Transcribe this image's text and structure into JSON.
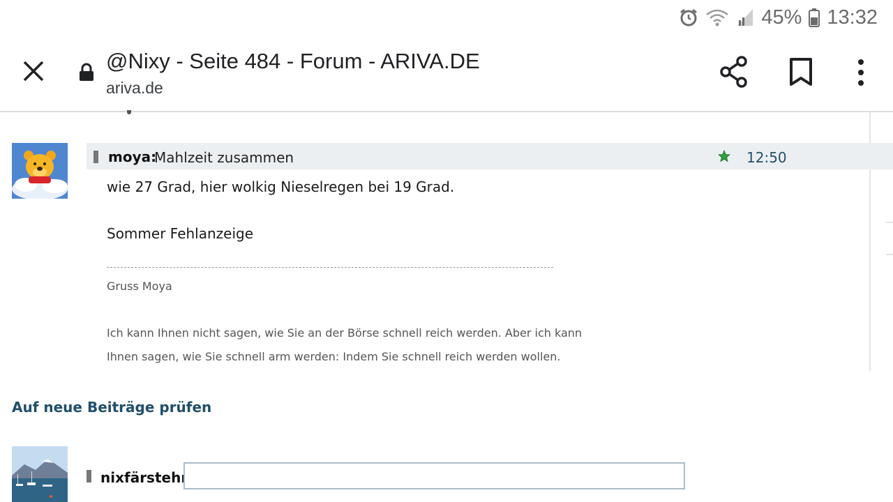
{
  "status_bar": {
    "battery_percent": "45%",
    "time": "13:32",
    "icons": [
      "alarm-icon",
      "wifi-icon",
      "signal-icon",
      "battery-icon"
    ]
  },
  "toolbar": {
    "title": "@Nixy - Seite 484 - Forum - ARIVA.DE",
    "url": "ariva.de",
    "icons": [
      "close-icon",
      "lock-icon",
      "share-icon",
      "bookmark-icon",
      "more-vert-icon"
    ]
  },
  "post": {
    "author": "moya:",
    "subject": "Mahlzeit zusammen",
    "time": "12:50",
    "body_line1": "wie 27 Grad, hier wolkig Nieselregen bei 19 Grad.",
    "body_line2": "Sommer Fehlanzeige",
    "signature_greeting": "Gruss Moya",
    "signature_quote_line1": "Ich kann Ihnen nicht sagen, wie Sie an der Börse schnell reich werden. Aber ich kann",
    "signature_quote_line2": "Ihnen sagen, wie Sie schnell arm werden: Indem Sie schnell reich werden wollen."
  },
  "check_new_posts_label": "Auf neue Beiträge prüfen",
  "reply": {
    "username": "nixfärstehn:",
    "input_value": ""
  },
  "colors": {
    "link": "#1f4f6b",
    "post_header_bg": "#eceff1",
    "star": "#2e9e3e"
  }
}
